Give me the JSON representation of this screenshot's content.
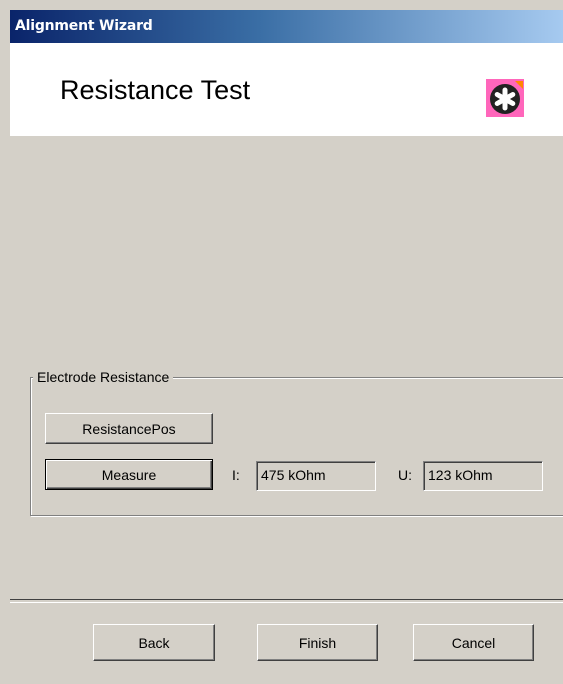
{
  "window": {
    "title": "Alignment Wizard"
  },
  "header": {
    "title": "Resistance Test",
    "logo_icon": "asterisk-logo-icon"
  },
  "group": {
    "legend": "Electrode Resistance",
    "resistance_pos_label": "ResistancePos",
    "measure_label": "Measure",
    "i_label": "I:",
    "i_value": "475 kOhm",
    "u_label": "U:",
    "u_value": "123 kOhm"
  },
  "footer": {
    "back_label": "Back",
    "finish_label": "Finish",
    "cancel_label": "Cancel"
  },
  "colors": {
    "dialog_bg": "#d4d0c8",
    "title_gradient_start": "#0a246a",
    "logo_pink": "#ff66bb",
    "logo_orange": "#ff8800"
  }
}
